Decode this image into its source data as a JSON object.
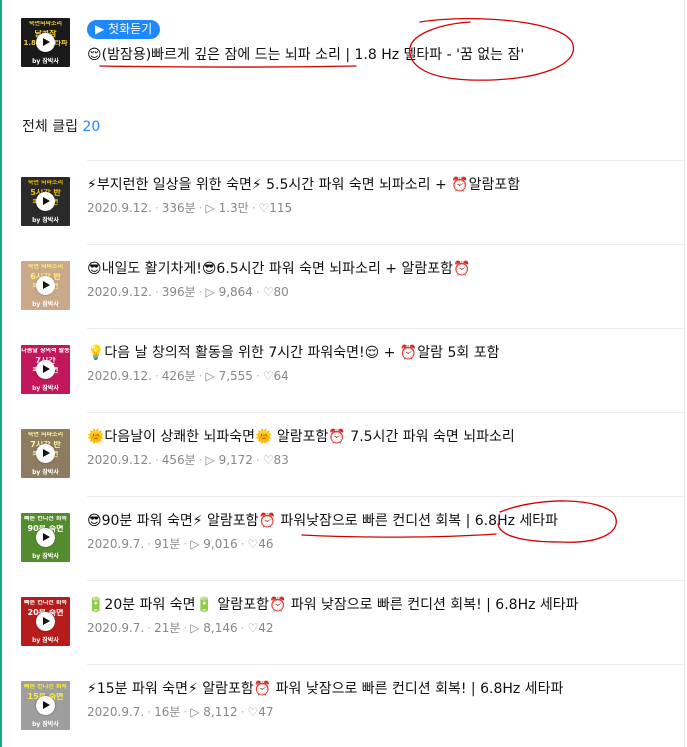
{
  "featured": {
    "listen_label": "▶ 첫화듣기",
    "emoji": "😌",
    "title": "(밤잠용)빠르게 깊은 잠에 드는 뇌파 소리 | 1.8 Hz 델타파 - '꿈 없는 잠'",
    "thumb": {
      "caption1": "숙면뇌파소리",
      "caption2": "달콤잠",
      "caption3": "1.8Hz 델타파",
      "by": "by 잠박사",
      "bg": "#1a1a1a",
      "fg": "#f4d03f"
    }
  },
  "section": {
    "label": "전체 클립",
    "count": "20"
  },
  "clips": [
    {
      "title": "⚡부지런한 일상을 위한 숙면⚡ 5.5시간 파워 숙면 뇌파소리 + ⏰알람포함",
      "date": "2020.9.12.",
      "duration": "336분",
      "plays": "1.3만",
      "likes": "115",
      "thumb": {
        "caption1": "숙면 뇌파소리",
        "caption2": "5시간 반",
        "caption3": "파워숙면",
        "by": "by 잠박사",
        "bg": "#2a2a2a",
        "fg": "#f2c200"
      }
    },
    {
      "title": "😎내일도 활기차게!😎6.5시간 파워 숙면 뇌파소리 + 알람포함⏰",
      "date": "2020.9.12.",
      "duration": "396분",
      "plays": "9,864",
      "likes": "80",
      "thumb": {
        "caption1": "숙면 뇌파소리",
        "caption2": "6시간 반",
        "caption3": "파워숙면",
        "by": "by 잠박사",
        "bg": "#c9a98a",
        "fg": "#fff176"
      }
    },
    {
      "title": "💡다음 날 창의적 활동을 위한 7시간 파워숙면!😌 + ⏰알람 5회 포함",
      "date": "2020.9.12.",
      "duration": "426분",
      "plays": "7,555",
      "likes": "64",
      "thumb": {
        "caption1": "다음날 창의적 활동",
        "caption2": "7시간",
        "caption3": "파워숙면",
        "by": "by 잠박사",
        "bg": "#c2185b",
        "fg": "#ffffff"
      }
    },
    {
      "title": "🌞다음날이 상쾌한 뇌파숙면🌞 알람포함⏰ 7.5시간 파워 숙면 뇌파소리",
      "date": "2020.9.12.",
      "duration": "456분",
      "plays": "9,172",
      "likes": "83",
      "thumb": {
        "caption1": "숙면 뇌파소리",
        "caption2": "7시간 반",
        "caption3": "파워숙면",
        "by": "by 잠박사",
        "bg": "#8d7b62",
        "fg": "#fff59d"
      }
    },
    {
      "title": "😎90분 파워 숙면⚡ 알람포함⏰ 파워낮잠으로 빠른 컨디션 회복 | 6.8Hz 세타파",
      "date": "2020.9.7.",
      "duration": "91분",
      "plays": "9,016",
      "likes": "46",
      "thumb": {
        "caption1": "빠른 컨디션 회복",
        "caption2": "90분 숙면",
        "caption3": "세타파",
        "by": "by 잠박사",
        "bg": "#558b2f",
        "fg": "#ffffff"
      }
    },
    {
      "title": "🔋20분 파워 숙면🔋 알람포함⏰ 파워 낮잠으로 빠른 컨디션 회복! | 6.8Hz 세타파",
      "date": "2020.9.7.",
      "duration": "21분",
      "plays": "8,146",
      "likes": "42",
      "thumb": {
        "caption1": "빠른 컨디션 회복",
        "caption2": "20분 숙면",
        "caption3": "세타파",
        "by": "by 잠박사",
        "bg": "#b71c1c",
        "fg": "#ffffff"
      }
    },
    {
      "title": "⚡15분 파워 숙면⚡ 알람포함⏰ 파워 낮잠으로 빠른 컨디션 회복! | 6.8Hz 세타파",
      "date": "2020.9.7.",
      "duration": "16분",
      "plays": "8,112",
      "likes": "47",
      "thumb": {
        "caption1": "빠른 컨디션 회복",
        "caption2": "15분 숙면",
        "caption3": "세타파",
        "by": "by 잠박사",
        "bg": "#9e9e9e",
        "fg": "#ffeb3b"
      }
    }
  ],
  "meta_icons": {
    "plays": "▷",
    "likes": "♡"
  },
  "annotation_color": "#d40000"
}
